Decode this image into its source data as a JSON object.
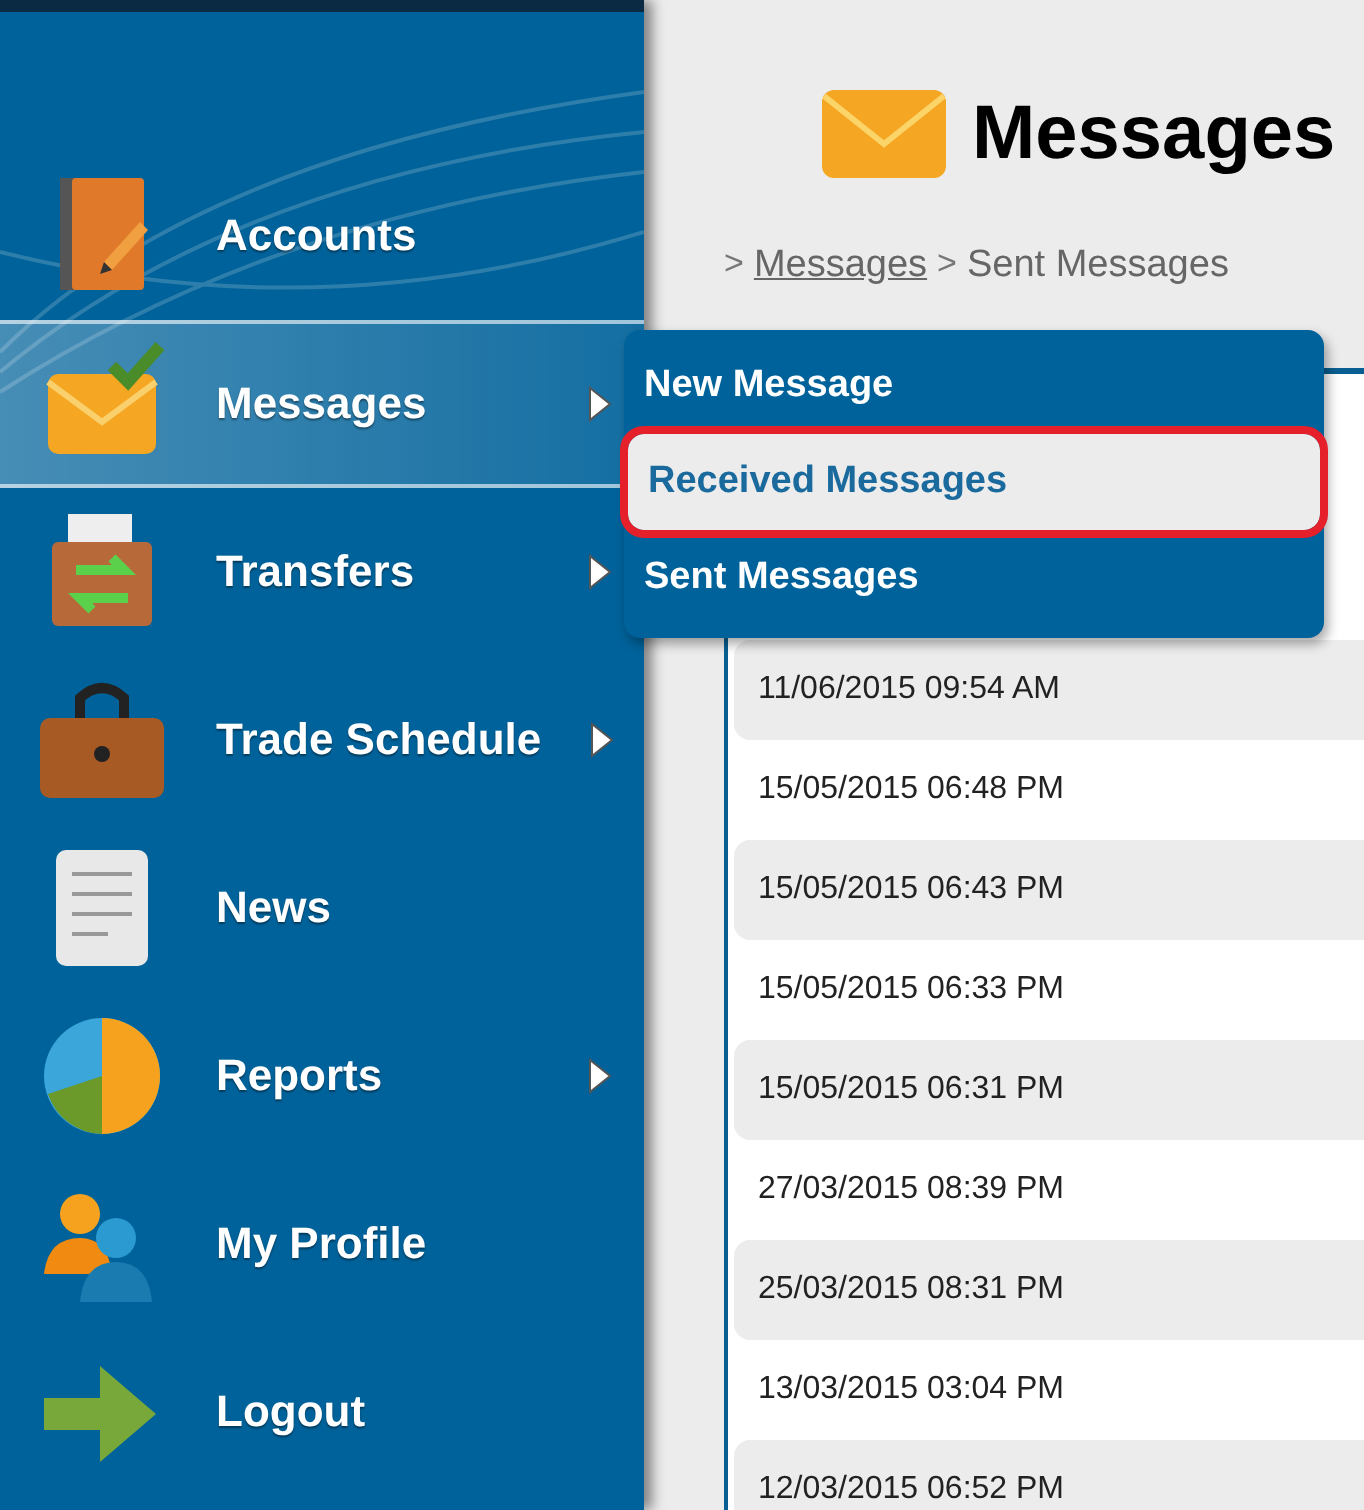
{
  "sidebar": {
    "items": [
      {
        "label": "Accounts",
        "has_submenu": false,
        "selected": false
      },
      {
        "label": "Messages",
        "has_submenu": true,
        "selected": true
      },
      {
        "label": "Transfers",
        "has_submenu": true,
        "selected": false
      },
      {
        "label": "Trade Schedule",
        "has_submenu": true,
        "selected": false
      },
      {
        "label": "News",
        "has_submenu": false,
        "selected": false
      },
      {
        "label": "Reports",
        "has_submenu": true,
        "selected": false
      },
      {
        "label": "My Profile",
        "has_submenu": false,
        "selected": false
      },
      {
        "label": "Logout",
        "has_submenu": false,
        "selected": false
      }
    ]
  },
  "submenu": {
    "items": [
      {
        "label": "New Message",
        "selected": false,
        "highlighted": false
      },
      {
        "label": "Received Messages",
        "selected": true,
        "highlighted": true
      },
      {
        "label": "Sent Messages",
        "selected": false,
        "highlighted": false
      }
    ]
  },
  "page": {
    "title": "Messages",
    "breadcrumb": [
      {
        "separator": ">",
        "label": "Messages",
        "link": true
      },
      {
        "separator": ">",
        "label": "Sent Messages",
        "link": false
      }
    ]
  },
  "table": {
    "rows": [
      {
        "date": "11/06/2015 09:54 AM"
      },
      {
        "date": "15/05/2015 06:48 PM"
      },
      {
        "date": "15/05/2015 06:43 PM"
      },
      {
        "date": "15/05/2015 06:33 PM"
      },
      {
        "date": "15/05/2015 06:31 PM"
      },
      {
        "date": "27/03/2015 08:39 PM"
      },
      {
        "date": "25/03/2015 08:31 PM"
      },
      {
        "date": "13/03/2015 03:04 PM"
      },
      {
        "date": "12/03/2015 06:52 PM"
      }
    ]
  }
}
